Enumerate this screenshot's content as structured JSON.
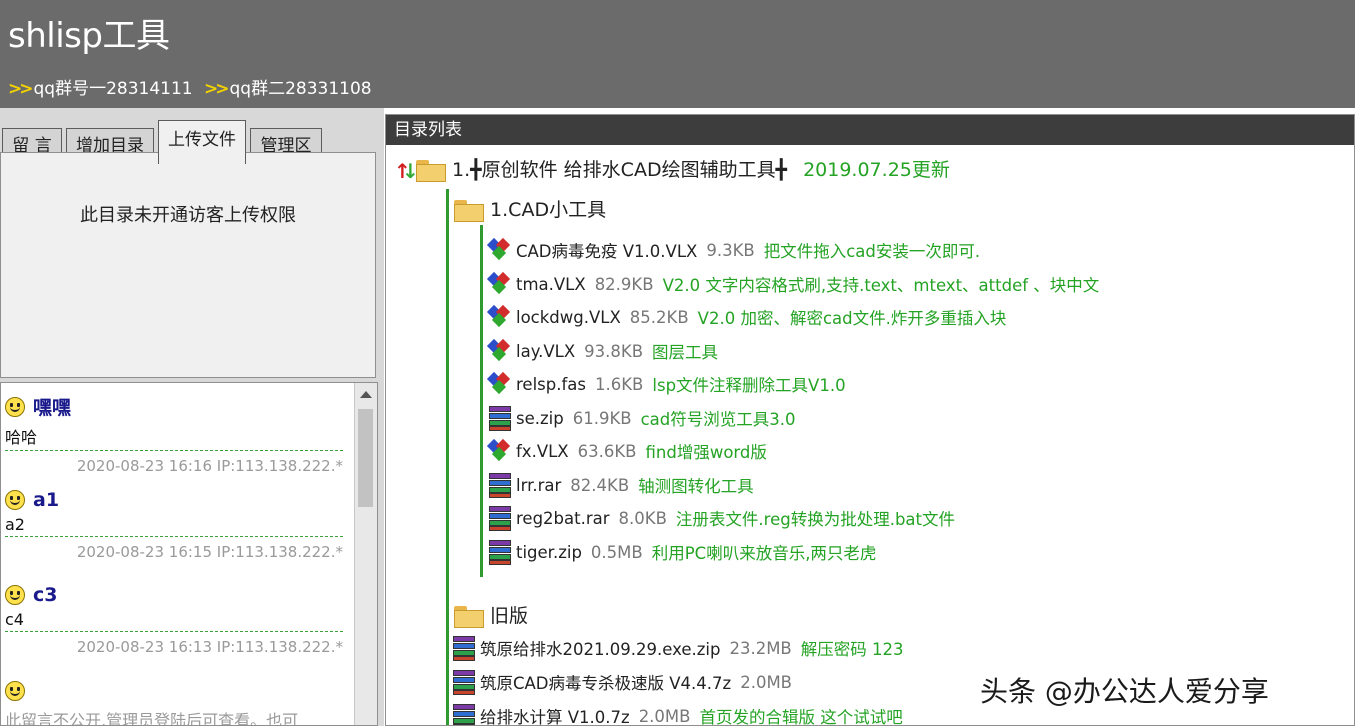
{
  "header": {
    "title": "shlisp工具",
    "qq_links": [
      "qq群号一28314111",
      "qq群二28331108"
    ]
  },
  "left": {
    "tabs": [
      "留 言",
      "增加目录",
      "上传文件",
      "管理区"
    ],
    "active_tab": "上传文件",
    "upload_notice": "此目录未开通访客上传权限",
    "messages": [
      {
        "name": "嘿嘿",
        "text": "哈哈",
        "meta": "2020-08-23 16:16 IP:113.138.222.*"
      },
      {
        "name": "a1",
        "text": "a2",
        "meta": "2020-08-23 16:15 IP:113.138.222.*"
      },
      {
        "name": "c3",
        "text": "c4",
        "meta": "2020-08-23 16:13 IP:113.138.222.*"
      }
    ],
    "hidden_notice": "此留言不公开,管理员登陆后可查看。也可"
  },
  "directory": {
    "header": "目录列表",
    "root": {
      "prefix": "1.",
      "label": "原创软件 给排水CAD绘图辅助工具",
      "update": "2019.07.25更新"
    },
    "cad_tools_folder": "1.CAD小工具",
    "cad_tools": [
      {
        "icon": "vlx",
        "name": "CAD病毒免疫 V1.0.VLX",
        "size": "9.3KB",
        "desc": "把文件拖入cad安装一次即可."
      },
      {
        "icon": "vlx",
        "name": "tma.VLX",
        "size": "82.9KB",
        "desc": "V2.0 文字内容格式刷,支持.text、mtext、attdef 、块中文"
      },
      {
        "icon": "vlx",
        "name": "lockdwg.VLX",
        "size": "85.2KB",
        "desc": "V2.0 加密、解密cad文件.炸开多重插入块"
      },
      {
        "icon": "vlx",
        "name": "lay.VLX",
        "size": "93.8KB",
        "desc": "图层工具"
      },
      {
        "icon": "vlx",
        "name": "relsp.fas",
        "size": "1.6KB",
        "desc": "lsp文件注释删除工具V1.0"
      },
      {
        "icon": "zip",
        "name": "se.zip",
        "size": "61.9KB",
        "desc": "cad符号浏览工具3.0"
      },
      {
        "icon": "vlx",
        "name": "fx.VLX",
        "size": "63.6KB",
        "desc": "find增强word版"
      },
      {
        "icon": "zip",
        "name": "lrr.rar",
        "size": "82.4KB",
        "desc": "轴测图转化工具"
      },
      {
        "icon": "zip",
        "name": "reg2bat.rar",
        "size": "8.0KB",
        "desc": "注册表文件.reg转换为批处理.bat文件"
      },
      {
        "icon": "zip",
        "name": "tiger.zip",
        "size": "0.5MB",
        "desc": "利用PC喇叭来放音乐,两只老虎"
      }
    ],
    "old_folder": "旧版",
    "old_files": [
      {
        "icon": "zip",
        "name": "筑原给排水2021.09.29.exe.zip",
        "size": "23.2MB",
        "desc": "解压密码 123"
      },
      {
        "icon": "zip",
        "name": "筑原CAD病毒专杀极速版 V4.4.7z",
        "size": "2.0MB",
        "desc": ""
      },
      {
        "icon": "zip",
        "name": "给排水计算 V1.0.7z",
        "size": "2.0MB",
        "desc": "首页发的合辑版 这个试试吧"
      }
    ]
  },
  "watermark": "头条 @办公达人爱分享"
}
